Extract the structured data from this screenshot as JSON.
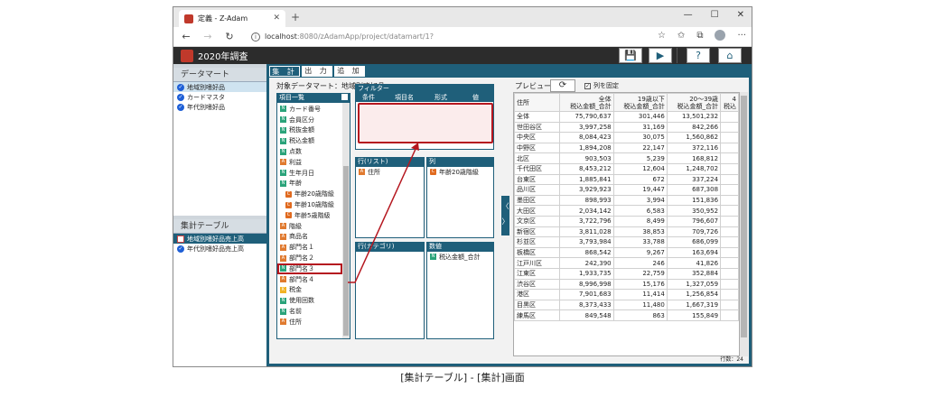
{
  "browser": {
    "tab_title": "定義 - Z-Adam",
    "tab_close": "✕",
    "new_tab": "+",
    "url_host": "localhost",
    "url_path": ":8080/zAdamApp/project/datamart/1?",
    "win_min": "—",
    "win_max": "☐",
    "win_close": "✕",
    "nav_back": "←",
    "nav_forward": "→",
    "nav_reload": "↻",
    "info": "i",
    "star": "☆",
    "fav": "✩",
    "collections": "⧉",
    "more": "···"
  },
  "app": {
    "title": "2020年調査",
    "save": "💾",
    "run": "▶",
    "help": "?",
    "home": "⌂"
  },
  "left": {
    "datamart_header": "データマート",
    "datamart_items": [
      "地域別嗜好品",
      "カードマスタ",
      "年代別嗜好品"
    ],
    "aggtable_header": "集計テーブル",
    "aggtable_items": [
      "地域別嗜好品売上高",
      "年代別嗜好品売上高"
    ]
  },
  "function_tabs": [
    "集 計",
    "出 力",
    "追 加"
  ],
  "target_label": "対象データマート：地域別嗜好品",
  "items_header": "項目一覧",
  "items": [
    {
      "label": "カード番号",
      "icon": "n"
    },
    {
      "label": "会員区分",
      "icon": "n"
    },
    {
      "label": "税抜金額",
      "icon": "n"
    },
    {
      "label": "税込金額",
      "icon": "n"
    },
    {
      "label": "点数",
      "icon": "n"
    },
    {
      "label": "利益",
      "icon": "a"
    },
    {
      "label": "生年月日",
      "icon": "n"
    },
    {
      "label": "年齢",
      "icon": "n"
    },
    {
      "label": "年齢20歳階級",
      "icon": "c",
      "indent": true
    },
    {
      "label": "年齢10歳階級",
      "icon": "c",
      "indent": true
    },
    {
      "label": "年齢5歳階級",
      "icon": "c",
      "indent": true
    },
    {
      "label": "階級",
      "icon": "a"
    },
    {
      "label": "商品名",
      "icon": "a"
    },
    {
      "label": "部門名１",
      "icon": "a"
    },
    {
      "label": "部門名２",
      "icon": "a"
    },
    {
      "label": "部門名３",
      "icon": "n",
      "selected": true
    },
    {
      "label": "部門名４",
      "icon": "a"
    },
    {
      "label": "税金",
      "icon": "k"
    },
    {
      "label": "使用回数",
      "icon": "n"
    },
    {
      "label": "名前",
      "icon": "n"
    },
    {
      "label": "住所",
      "icon": "a"
    }
  ],
  "filter": {
    "header": "フィルター",
    "col_condition": "条件",
    "col_item": "項目名",
    "col_format": "形式",
    "col_value": "値"
  },
  "rows_box": {
    "header": "行(リスト)",
    "items": [
      {
        "label": "住所",
        "icon": "a"
      }
    ]
  },
  "cols_box": {
    "header": "列",
    "items": [
      {
        "label": "年齢20歳階級",
        "icon": "c"
      }
    ]
  },
  "rows_cat_box": {
    "header": "行(カテゴリ)",
    "items": []
  },
  "values_box": {
    "header": "数値",
    "items": [
      {
        "label": "税込金額_合計",
        "icon": "n"
      }
    ]
  },
  "collapse_arrows": [
    "〈",
    "〉"
  ],
  "preview": {
    "label": "プレビュー",
    "refresh": "⟳",
    "fix_columns": "列を固定",
    "fix_checked": "✓",
    "headers": [
      "住所",
      "全体\n税込金額_合計",
      "19歳以下\n税込金額_合計",
      "20～39歳\n税込金額_合計",
      "4\n税込"
    ],
    "rows": [
      [
        "全体",
        "75,790,637",
        "301,446",
        "13,501,232"
      ],
      [
        "世田谷区",
        "3,997,258",
        "31,169",
        "842,266"
      ],
      [
        "中央区",
        "8,084,423",
        "30,075",
        "1,560,862"
      ],
      [
        "中野区",
        "1,894,208",
        "22,147",
        "372,116"
      ],
      [
        "北区",
        "903,503",
        "5,239",
        "168,812"
      ],
      [
        "千代田区",
        "8,453,212",
        "12,604",
        "1,248,702"
      ],
      [
        "台東区",
        "1,885,841",
        "672",
        "337,224"
      ],
      [
        "品川区",
        "3,929,923",
        "19,447",
        "687,308"
      ],
      [
        "墨田区",
        "898,993",
        "3,994",
        "151,836"
      ],
      [
        "大田区",
        "2,034,142",
        "6,583",
        "350,952"
      ],
      [
        "文京区",
        "3,722,796",
        "8,499",
        "796,607"
      ],
      [
        "新宿区",
        "3,811,028",
        "38,853",
        "709,726"
      ],
      [
        "杉並区",
        "3,793,984",
        "33,788",
        "686,099"
      ],
      [
        "板橋区",
        "868,542",
        "9,267",
        "163,694"
      ],
      [
        "江戸川区",
        "242,390",
        "246",
        "41,826"
      ],
      [
        "江東区",
        "1,933,735",
        "22,759",
        "352,884"
      ],
      [
        "渋谷区",
        "8,996,998",
        "15,176",
        "1,327,059"
      ],
      [
        "港区",
        "7,901,683",
        "11,414",
        "1,256,854"
      ],
      [
        "目黒区",
        "8,373,433",
        "11,480",
        "1,667,319"
      ],
      [
        "練馬区",
        "849,548",
        "863",
        "155,849"
      ]
    ],
    "row_count": "行数：24"
  },
  "caption": "[集計テーブル] - [集計]画面"
}
